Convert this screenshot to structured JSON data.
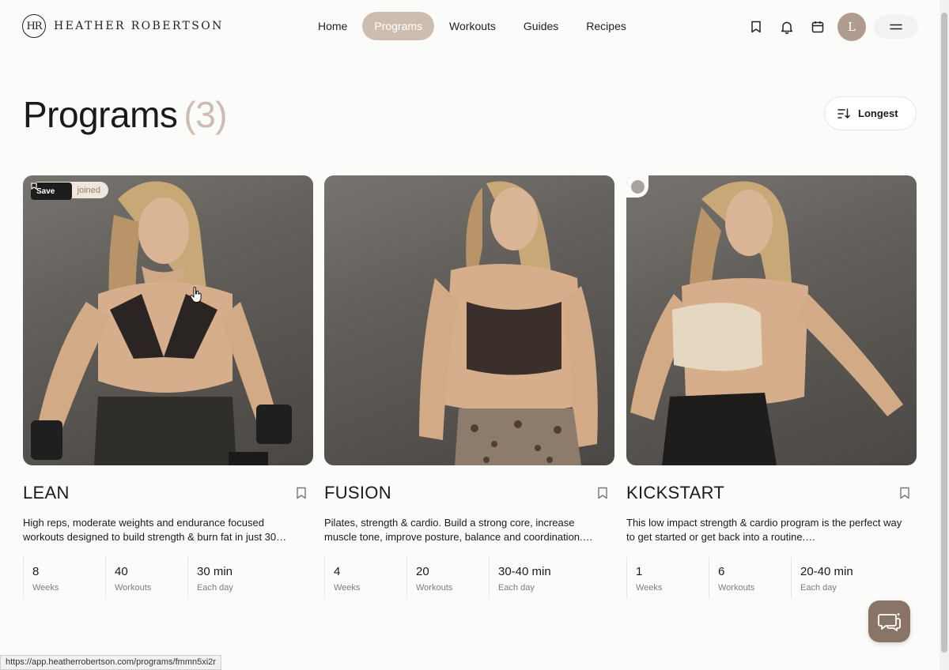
{
  "brand": {
    "mark": "HR",
    "name": "HEATHER ROBERTSON"
  },
  "nav": [
    {
      "label": "Home"
    },
    {
      "label": "Programs",
      "active": true
    },
    {
      "label": "Workouts"
    },
    {
      "label": "Guides"
    },
    {
      "label": "Recipes"
    }
  ],
  "header_icons": [
    "bookmark-icon",
    "bell-icon",
    "calendar-icon"
  ],
  "user": {
    "initial": "L"
  },
  "page": {
    "title": "Programs",
    "count": "(3)"
  },
  "sort": {
    "label": "Longest",
    "icon": "sort-icon"
  },
  "cards": [
    {
      "title": "LEAN",
      "description": "High reps, moderate weights and endurance focused workouts designed to build strength & burn fat in just 30…",
      "badge": "joined",
      "save_label": "Save",
      "stats": [
        {
          "value": "8",
          "label": "Weeks"
        },
        {
          "value": "40",
          "label": "Workouts"
        },
        {
          "value": "30 min",
          "label": "Each day"
        }
      ]
    },
    {
      "title": "FUSION",
      "description": "Pilates, strength & cardio. Build a strong core, increase muscle tone, improve posture, balance and coordination.…",
      "stats": [
        {
          "value": "4",
          "label": "Weeks"
        },
        {
          "value": "20",
          "label": "Workouts"
        },
        {
          "value": "30-40 min",
          "label": "Each day"
        }
      ]
    },
    {
      "title": "KICKSTART",
      "description": "This low impact strength & cardio program is the perfect way to get started or get back into a routine.…",
      "completed": true,
      "stats": [
        {
          "value": "1",
          "label": "Weeks"
        },
        {
          "value": "6",
          "label": "Workouts"
        },
        {
          "value": "20-40 min",
          "label": "Each day"
        }
      ]
    }
  ],
  "status_bar": {
    "url": "https://app.heatherrobertson.com/programs/fmmn5xi2r"
  },
  "colors": {
    "accent": "#cdbcb0",
    "avatar": "#b09c8f",
    "chat": "#8a7467"
  }
}
